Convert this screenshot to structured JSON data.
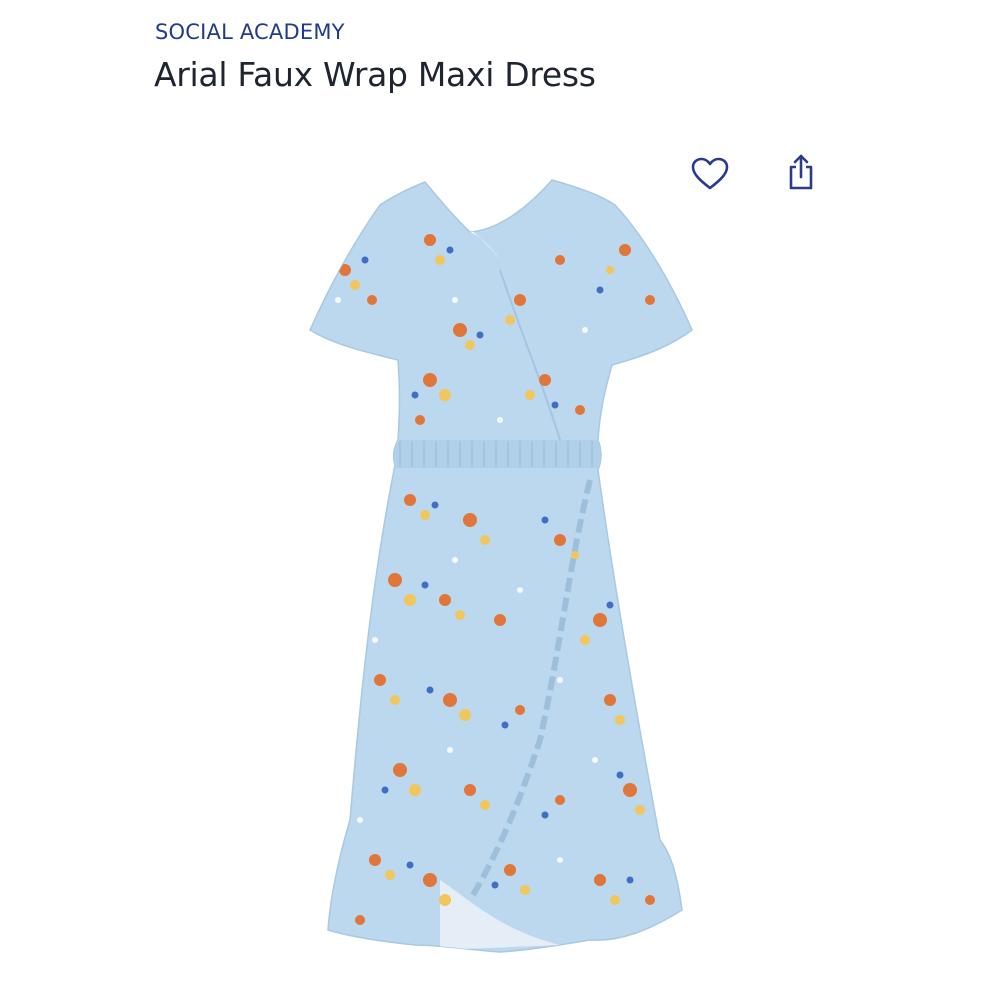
{
  "product": {
    "brand": "SOCIAL ACADEMY",
    "title": "Arial Faux Wrap Maxi Dress",
    "image_alt": "Light blue floral faux wrap maxi dress"
  },
  "actions": {
    "favorite_icon": "heart-icon",
    "share_icon": "share-icon"
  },
  "colors": {
    "brand": "#1f3b8a",
    "title": "#1e2430",
    "dress_base": "#bcd8ee",
    "flower_orange": "#e0763a",
    "flower_yellow": "#f1c65a",
    "flower_blue": "#3f6fc2"
  }
}
